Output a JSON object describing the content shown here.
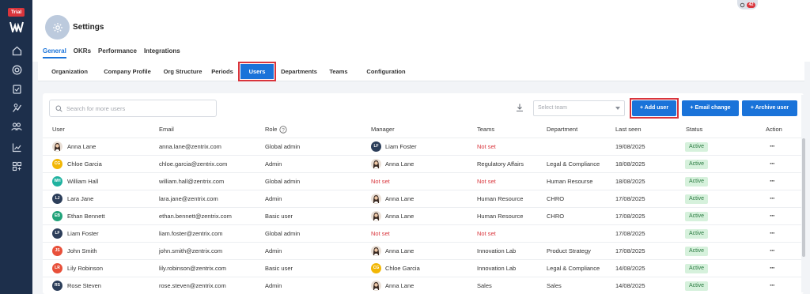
{
  "sidebar": {
    "trial_label": "Trial",
    "icons": [
      "home-icon",
      "target-icon",
      "clipboard-icon",
      "analytics-icon",
      "team-icon",
      "trend-icon",
      "grid-plus-icon"
    ]
  },
  "header": {
    "title": "Settings",
    "notification_count": "42",
    "tabs": [
      "General",
      "OKRs",
      "Performance",
      "Integrations"
    ],
    "active_tab": "General"
  },
  "subtabs": {
    "items": [
      "Organization",
      "Company Profile",
      "Org Structure",
      "Periods",
      "Users",
      "Departments",
      "Teams",
      "Configuration"
    ],
    "active": "Users"
  },
  "toolbar": {
    "search_placeholder": "Search for more users",
    "select_team_placeholder": "Select team",
    "add_user": "+ Add user",
    "email_change": "+ Email change",
    "archive_user": "+ Archive user"
  },
  "table": {
    "headers": [
      "User",
      "Email",
      "Role",
      "Manager",
      "Teams",
      "Department",
      "Last seen",
      "Status",
      "Action"
    ],
    "action_label": "···",
    "rows": [
      {
        "initials": "",
        "name": "Anna Lane",
        "email": "anna.lane@zentrix.com",
        "role": "Global admin",
        "manager": "Liam Foster",
        "manager_initials": "LF",
        "teams": "Not set",
        "department": "",
        "last_seen": "19/08/2025",
        "status": "Active"
      },
      {
        "initials": "CG",
        "name": "Chloe Garcia",
        "email": "chloe.garcia@zentrix.com",
        "role": "Admin",
        "manager": "Anna Lane",
        "manager_initials": "",
        "teams": "Regulatory Affairs",
        "department": "Legal & Compliance",
        "last_seen": "18/08/2025",
        "status": "Active"
      },
      {
        "initials": "WH",
        "name": "William Hall",
        "email": "william.hall@zentrix.com",
        "role": "Global admin",
        "manager": "Not set",
        "manager_initials": null,
        "teams": "Not set",
        "department": "Human Resourse",
        "last_seen": "18/08/2025",
        "status": "Active"
      },
      {
        "initials": "LJ",
        "name": "Lara Jane",
        "email": "lara.jane@zentrix.com",
        "role": "Admin",
        "manager": "Anna Lane",
        "manager_initials": "",
        "teams": "Human Resource",
        "department": "CHRO",
        "last_seen": "17/08/2025",
        "status": "Active"
      },
      {
        "initials": "EB",
        "name": "Ethan Bennett",
        "email": "ethan.bennett@zentrix.com",
        "role": "Basic user",
        "manager": "Anna Lane",
        "manager_initials": "",
        "teams": "Human Resource",
        "department": "CHRO",
        "last_seen": "17/08/2025",
        "status": "Active"
      },
      {
        "initials": "LF",
        "name": "Liam Foster",
        "email": "liam.foster@zentrix.com",
        "role": "Global admin",
        "manager": "Not set",
        "manager_initials": null,
        "teams": "Not set",
        "department": "",
        "last_seen": "17/08/2025",
        "status": "Active"
      },
      {
        "initials": "JS",
        "name": "John Smith",
        "email": "john.smith@zentrix.com",
        "role": "Admin",
        "manager": "Anna Lane",
        "manager_initials": "",
        "teams": "Innovation Lab",
        "department": "Product Strategy",
        "last_seen": "17/08/2025",
        "status": "Active"
      },
      {
        "initials": "LR",
        "name": "Lily Robinson",
        "email": "lily.robinson@zentrix.com",
        "role": "Basic user",
        "manager": "Chloe Garcia",
        "manager_initials": "CG",
        "teams": "Innovation Lab",
        "department": "Legal & Compliance",
        "last_seen": "14/08/2025",
        "status": "Active"
      },
      {
        "initials": "RS",
        "name": "Rose Steven",
        "email": "rose.steven@zentrix.com",
        "role": "Admin",
        "manager": "Anna Lane",
        "manager_initials": "",
        "teams": "Sales",
        "department": "Sales",
        "last_seen": "14/08/2025",
        "status": "Active"
      }
    ]
  },
  "colors": {
    "brand_blue": "#1a73d9",
    "sidebar": "#1d2f4b",
    "not_set": "#d9353c",
    "status_active_bg": "#d6f1dc",
    "avatar_CG": "#f2b705",
    "avatar_WH": "#20b2a0",
    "avatar_LJ": "#2c3e5a",
    "avatar_EB": "#22a37a",
    "avatar_LF": "#2c3e5a",
    "avatar_JS": "#e8503a",
    "avatar_LR": "#e8503a",
    "avatar_RS": "#2c3e5a"
  }
}
